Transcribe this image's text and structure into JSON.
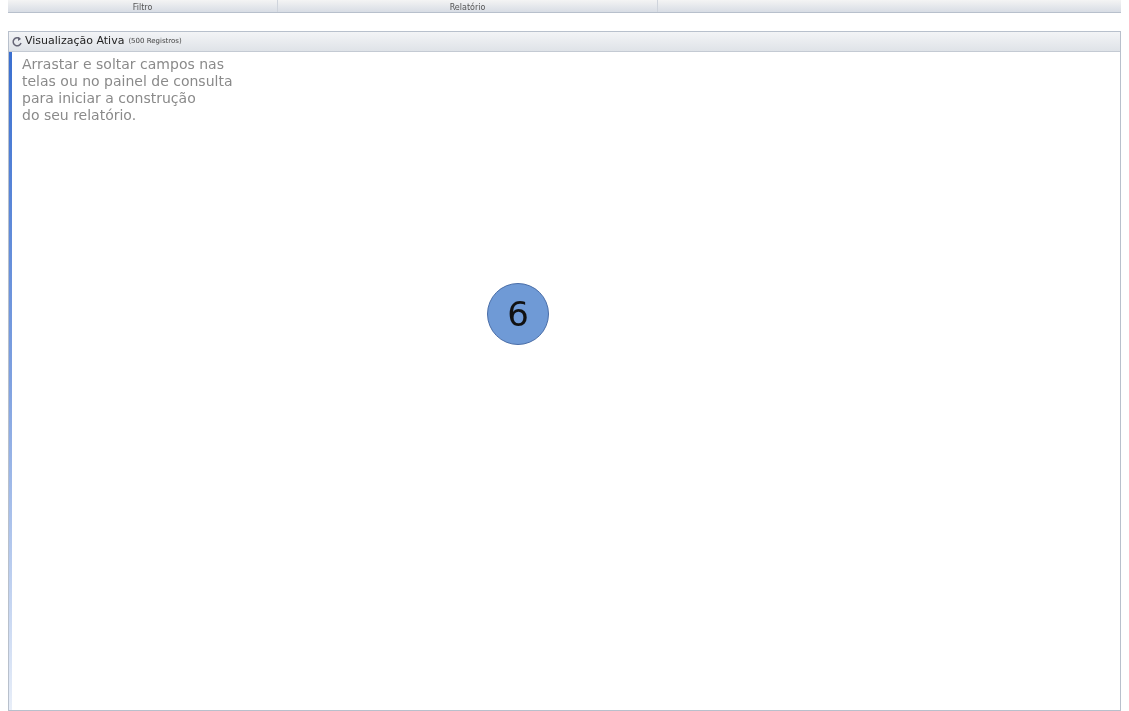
{
  "top_tabs": [
    {
      "label": "Filtro"
    },
    {
      "label": "Relatório"
    }
  ],
  "panel": {
    "title": "Visualização Ativa",
    "count": "(500 Registros)",
    "message_lines": [
      "Arrastar e soltar campos nas",
      "telas ou no painel de consulta",
      "para iniciar a construção",
      "do seu relatório."
    ]
  },
  "callout": {
    "label": "6"
  }
}
